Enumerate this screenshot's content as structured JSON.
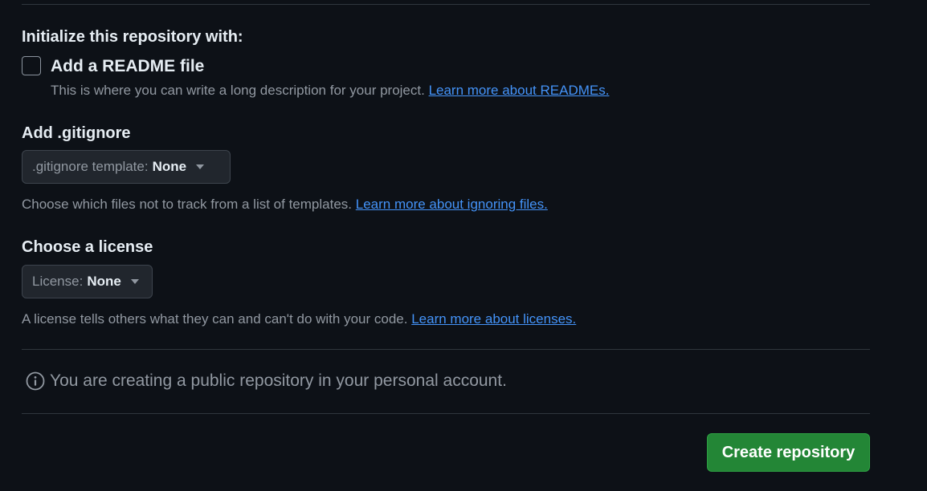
{
  "initialize": {
    "heading": "Initialize this repository with:",
    "readme": {
      "checked": false,
      "label": "Add a README file",
      "description": "This is where you can write a long description for your project.",
      "link": "Learn more about READMEs."
    }
  },
  "gitignore": {
    "heading": "Add .gitignore",
    "select_prefix": ".gitignore template:",
    "select_value": "None",
    "description": "Choose which files not to track from a list of templates.",
    "link": "Learn more about ignoring files."
  },
  "license": {
    "heading": "Choose a license",
    "select_prefix": "License:",
    "select_value": "None",
    "description": "A license tells others what they can and can't do with your code.",
    "link": "Learn more about licenses."
  },
  "notice": {
    "icon": "info-icon",
    "text": "You are creating a public repository in your personal account."
  },
  "actions": {
    "create_label": "Create repository"
  },
  "colors": {
    "background": "#0d1117",
    "accent_link": "#4493f8",
    "primary_button": "#238636"
  }
}
